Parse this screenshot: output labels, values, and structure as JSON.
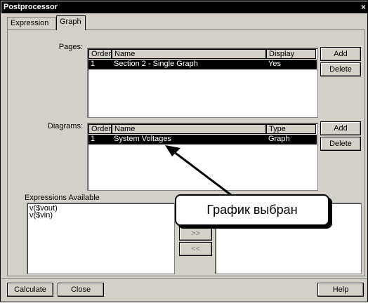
{
  "window": {
    "title": "Postprocessor",
    "close_glyph": "×"
  },
  "tabs": [
    {
      "label": "Expression"
    },
    {
      "label": "Graph"
    }
  ],
  "pages": {
    "label": "Pages:",
    "columns": [
      "Order",
      "Name",
      "Display"
    ],
    "rows": [
      {
        "order": "1",
        "name": "Section 2 - Single Graph",
        "display": "Yes"
      }
    ],
    "add_label": "Add",
    "delete_label": "Delete"
  },
  "diagrams": {
    "label": "Diagrams:",
    "columns": [
      "Order",
      "Name",
      "Type"
    ],
    "rows": [
      {
        "order": "1",
        "name": "System Voltages",
        "type": "Graph"
      }
    ],
    "add_label": "Add",
    "delete_label": "Delete"
  },
  "expressions": {
    "label": "Expressions Available",
    "items": [
      "v($vout)",
      "v($vin)"
    ],
    "move_right": ">>",
    "move_left": "<<"
  },
  "callout": {
    "text": "График выбран"
  },
  "footer": {
    "calculate_label": "Calculate",
    "close_label": "Close",
    "help_label": "Help"
  }
}
